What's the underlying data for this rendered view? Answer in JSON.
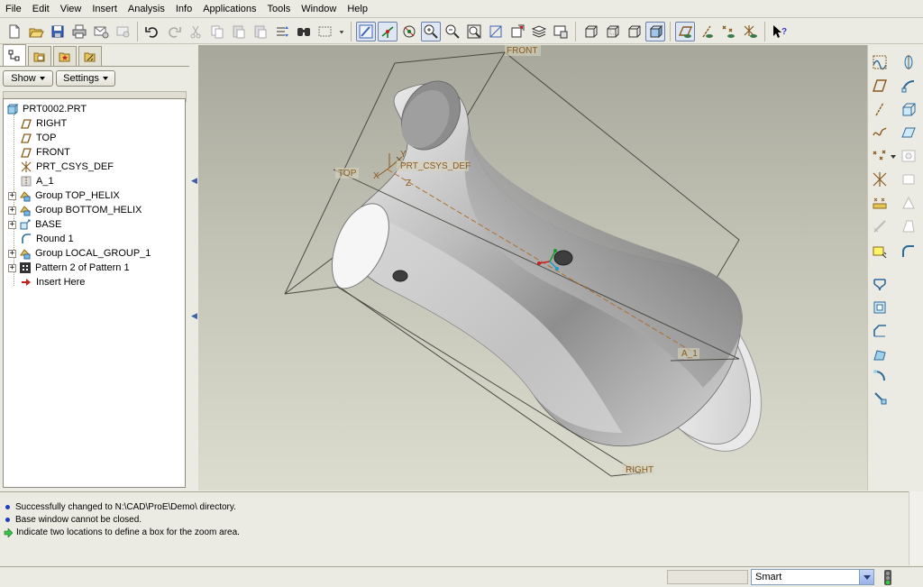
{
  "menubar": {
    "items": [
      "File",
      "Edit",
      "View",
      "Insert",
      "Analysis",
      "Info",
      "Applications",
      "Tools",
      "Window",
      "Help"
    ]
  },
  "navigator": {
    "show_label": "Show",
    "settings_label": "Settings",
    "tree": [
      {
        "label": "PRT0002.PRT",
        "icon": "part-icon",
        "expandable": false,
        "level": 0
      },
      {
        "label": "RIGHT",
        "icon": "datum-plane-icon",
        "expandable": false,
        "level": 1
      },
      {
        "label": "TOP",
        "icon": "datum-plane-icon",
        "expandable": false,
        "level": 1
      },
      {
        "label": "FRONT",
        "icon": "datum-plane-icon",
        "expandable": false,
        "level": 1
      },
      {
        "label": "PRT_CSYS_DEF",
        "icon": "csys-icon",
        "expandable": false,
        "level": 1
      },
      {
        "label": "A_1",
        "icon": "axis-icon",
        "expandable": false,
        "level": 1
      },
      {
        "label": "Group TOP_HELIX",
        "icon": "group-icon",
        "expandable": true,
        "level": 1
      },
      {
        "label": "Group BOTTOM_HELIX",
        "icon": "group-icon",
        "expandable": true,
        "level": 1
      },
      {
        "label": "BASE",
        "icon": "extrude-icon",
        "expandable": true,
        "level": 1
      },
      {
        "label": "Round 1",
        "icon": "round-icon",
        "expandable": false,
        "level": 1
      },
      {
        "label": "Group LOCAL_GROUP_1",
        "icon": "group-icon",
        "expandable": true,
        "level": 1
      },
      {
        "label": "Pattern 2 of Pattern 1",
        "icon": "pattern-icon",
        "expandable": true,
        "level": 1
      },
      {
        "label": "Insert Here",
        "icon": "insert-arrow-icon",
        "expandable": false,
        "level": 1
      }
    ]
  },
  "viewport": {
    "labels": {
      "front": "FRONT",
      "top": "TOP",
      "right": "RIGHT",
      "csys": "PRT_CSYS_DEF",
      "axis": "A_1",
      "csys_x": "X",
      "csys_y": "Y",
      "csys_z": "Z"
    }
  },
  "messages": [
    {
      "type": "info",
      "text": "Successfully changed to N:\\CAD\\ProE\\Demo\\ directory."
    },
    {
      "type": "info",
      "text": "Base window cannot be closed."
    },
    {
      "type": "prompt",
      "text": "Indicate two locations to define a box for the zoom area."
    }
  ],
  "statusbar": {
    "filter_value": "Smart"
  },
  "colors": {
    "model_surface": "#b9b9b9",
    "datum_label": "#8a5a1c",
    "selection_blue": "#1a3fbf"
  }
}
